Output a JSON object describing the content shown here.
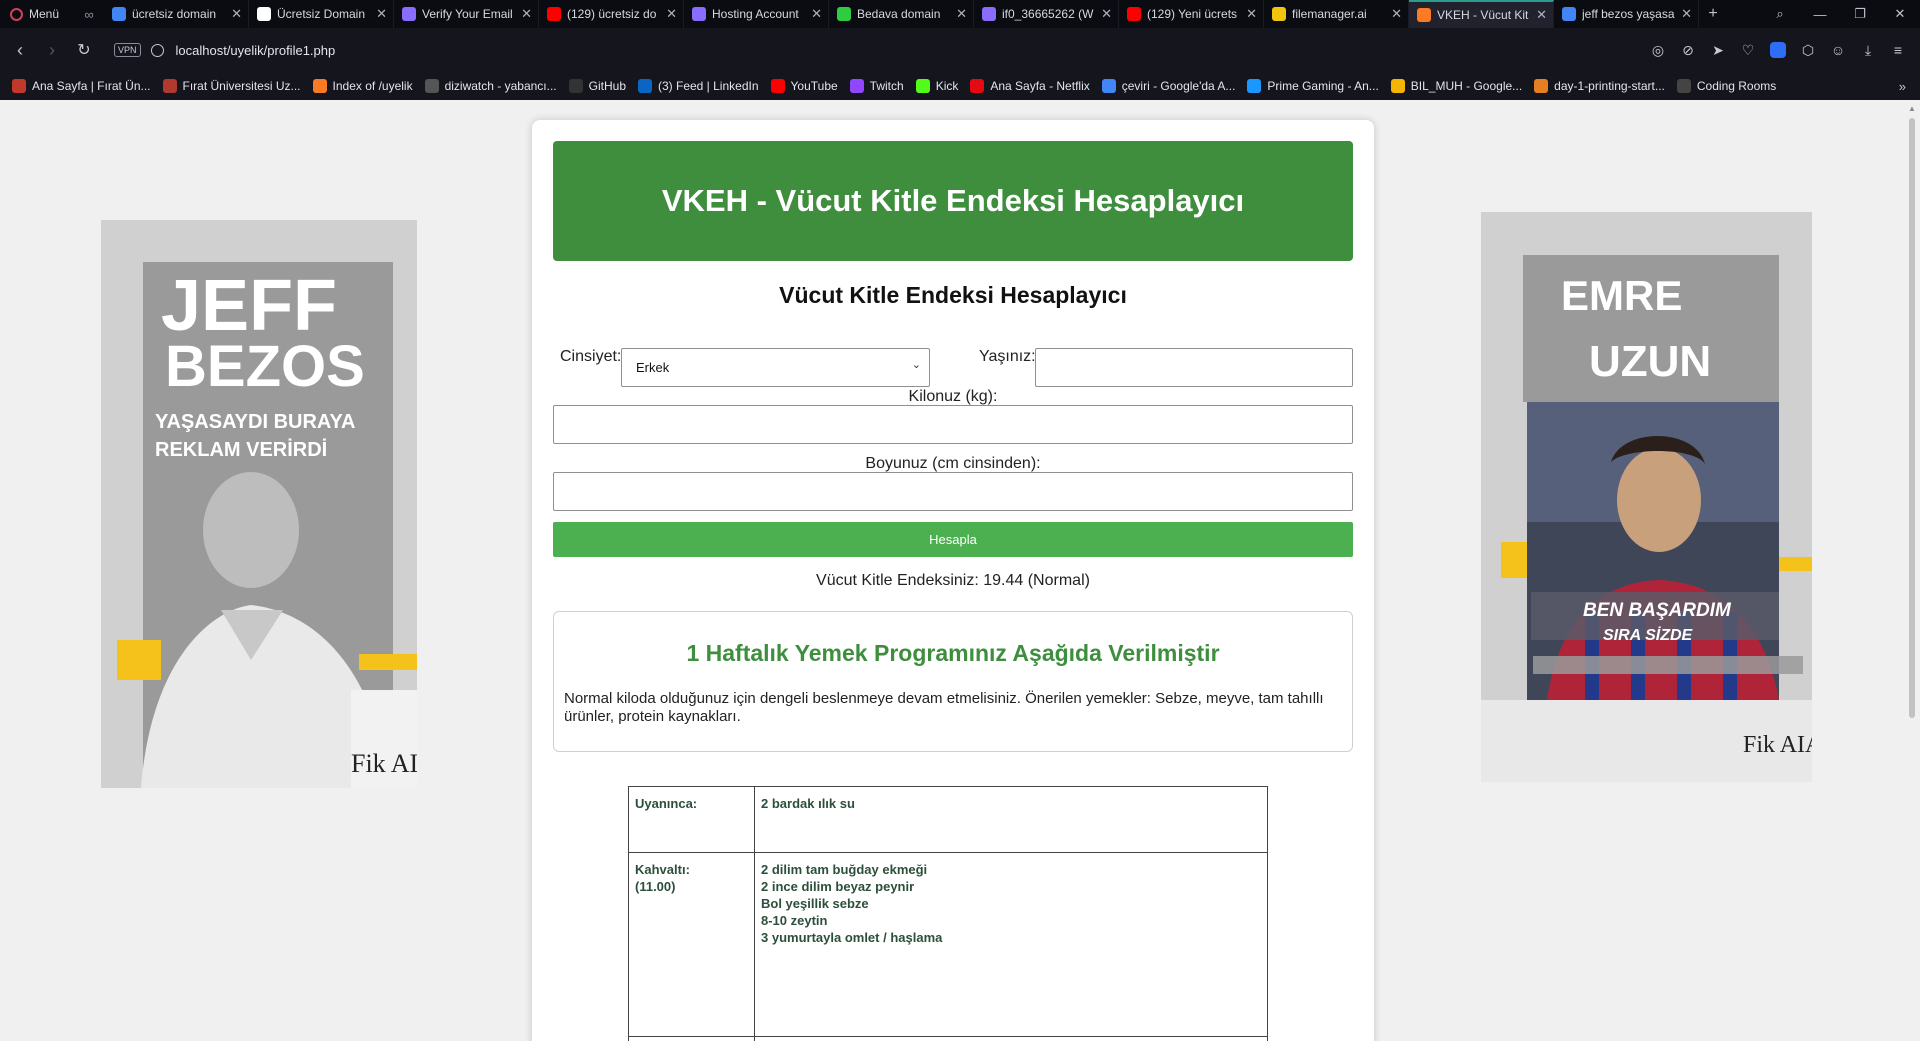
{
  "browser": {
    "menu_label": "Menü",
    "tabs": [
      {
        "title": "ücretsiz domain",
        "icon": "google-icon",
        "color": "#4285f4"
      },
      {
        "title": "Ücretsiz Domain",
        "icon": "wix-icon",
        "color": "#ffffff"
      },
      {
        "title": "Verify Your Email",
        "icon": "infinity-icon",
        "color": "#8a6cff"
      },
      {
        "title": "(129) ücretsiz do",
        "icon": "youtube-icon",
        "color": "#ff0000"
      },
      {
        "title": "Hosting Account",
        "icon": "infinity-icon",
        "color": "#8a6cff"
      },
      {
        "title": "Bedava domain",
        "icon": "power-icon",
        "color": "#2ecc40"
      },
      {
        "title": "if0_36665262 (W",
        "icon": "infinity-icon",
        "color": "#8a6cff"
      },
      {
        "title": "(129) Yeni ücrets",
        "icon": "youtube-icon",
        "color": "#ff0000"
      },
      {
        "title": "filemanager.ai",
        "icon": "filemanager-icon",
        "color": "#f1c40f"
      },
      {
        "title": "VKEH - Vücut Kit",
        "icon": "xampp-icon",
        "color": "#fb7a24",
        "active": true
      },
      {
        "title": "jeff bezos yaşasa",
        "icon": "google-icon",
        "color": "#4285f4"
      }
    ],
    "url": "localhost/uyelik/profile1.php",
    "vpn_label": "VPN",
    "bookmarks": [
      {
        "label": "Ana Sayfa | Fırat Ün...",
        "color": "#c0392b"
      },
      {
        "label": "Fırat Üniversitesi Uz...",
        "color": "#b03a2e"
      },
      {
        "label": "Index of /uyelik",
        "color": "#fb7a24"
      },
      {
        "label": "diziwatch - yabancı...",
        "color": "#555555"
      },
      {
        "label": "GitHub",
        "color": "#333333"
      },
      {
        "label": "(3) Feed | LinkedIn",
        "color": "#0a66c2"
      },
      {
        "label": "YouTube",
        "color": "#ff0000"
      },
      {
        "label": "Twitch",
        "color": "#9146ff"
      },
      {
        "label": "Kick",
        "color": "#53fc18"
      },
      {
        "label": "Ana Sayfa - Netflix",
        "color": "#e50914"
      },
      {
        "label": "çeviri - Google'da A...",
        "color": "#4285f4"
      },
      {
        "label": "Prime Gaming - An...",
        "color": "#1a98ff"
      },
      {
        "label": "BIL_MUH - Google...",
        "color": "#f4b400"
      },
      {
        "label": "day-1-printing-start...",
        "color": "#e67e22"
      },
      {
        "label": "Coding Rooms",
        "color": "#444444"
      }
    ]
  },
  "ads": {
    "left": {
      "line1": "JEFF",
      "line2": "BEZOS",
      "line3": "YAŞASAYDI BURAYA",
      "line4": "REKLAM VERİRDİ",
      "corner": "Fik AIAM"
    },
    "right": {
      "line1": "EMRE",
      "line2": "UZUN",
      "line3": "BEN BAŞARDIM",
      "line4": "SIRA SİZDE",
      "corner": "Fik AIAM"
    }
  },
  "page": {
    "banner_title": "VKEH - Vücut Kitle Endeksi Hesaplayıcı",
    "form_title": "Vücut Kitle Endeksi Hesaplayıcı",
    "gender_label": "Cinsiyet:",
    "gender_value": "Erkek",
    "age_label": "Yaşınız:",
    "age_value": "",
    "weight_label": "Kilonuz (kg):",
    "weight_value": "",
    "height_label": "Boyunuz (cm cinsinden):",
    "height_value": "",
    "submit_label": "Hesapla",
    "result_text": "Vücut Kitle Endeksiniz: 19.44 (Normal)",
    "program_title": "1 Haftalık Yemek Programınız Aşağıda Verilmiştir",
    "program_text": "Normal kiloda olduğunuz için dengeli beslenmeye devam etmelisiniz. Önerilen yemekler: Sebze, meyve, tam tahıllı ürünler, protein kaynakları.",
    "meals": [
      {
        "time": "Uyanınca:",
        "items": [
          "2 bardak ılık su"
        ]
      },
      {
        "time": "Kahvaltı: (11.00)",
        "items": [
          "2 dilim tam buğday ekmeği",
          "2 ince dilim beyaz peynir",
          "Bol yeşillik sebze",
          "8-10 zeytin",
          "3 yumurtayla omlet / haşlama"
        ]
      }
    ]
  }
}
